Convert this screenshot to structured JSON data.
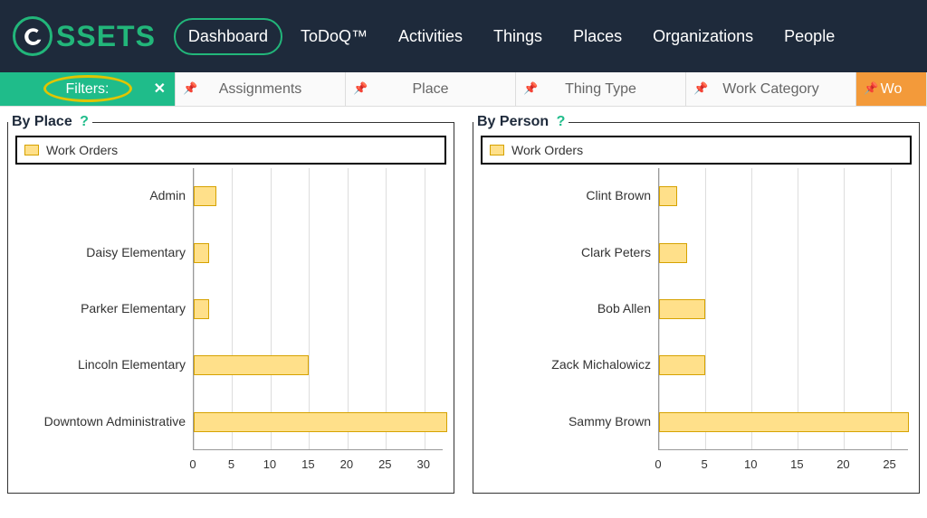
{
  "brand": {
    "name": "SSETS"
  },
  "nav": {
    "items": [
      {
        "label": "Dashboard",
        "active": true
      },
      {
        "label": "ToDoQ™"
      },
      {
        "label": "Activities"
      },
      {
        "label": "Things"
      },
      {
        "label": "Places"
      },
      {
        "label": "Organizations"
      },
      {
        "label": "People"
      }
    ]
  },
  "filters": {
    "label": "Filters:",
    "close": "✕",
    "tabs": [
      {
        "label": "Assignments"
      },
      {
        "label": "Place"
      },
      {
        "label": "Thing Type"
      },
      {
        "label": "Work Category"
      },
      {
        "label": "Wo",
        "orange": true
      }
    ]
  },
  "colors": {
    "accent": "#1fbc8a",
    "bar_fill": "#ffe08a",
    "bar_stroke": "#d6a200",
    "highlight_ring": "#e0c500",
    "nav_bg": "#1e2a3b",
    "orange": "#f39a3a"
  },
  "panels": {
    "by_place": {
      "title": "By Place",
      "help": "?",
      "legend": "Work Orders"
    },
    "by_person": {
      "title": "By Person",
      "help": "?",
      "legend": "Work Orders"
    }
  },
  "chart_data": [
    {
      "type": "bar",
      "orientation": "horizontal",
      "title": "By Place",
      "series_name": "Work Orders",
      "xlabel": "",
      "ylabel": "",
      "xlim": [
        0,
        32.5
      ],
      "xticks": [
        0,
        5,
        10,
        15,
        20,
        25,
        30
      ],
      "categories": [
        "Admin",
        "Daisy Elementary",
        "Parker Elementary",
        "Lincoln Elementary",
        "Downtown Administrative"
      ],
      "values": [
        3,
        2,
        2,
        15,
        33
      ]
    },
    {
      "type": "bar",
      "orientation": "horizontal",
      "title": "By Person",
      "series_name": "Work Orders",
      "xlabel": "",
      "ylabel": "",
      "xlim": [
        0,
        27
      ],
      "xticks": [
        0,
        5,
        10,
        15,
        20,
        25
      ],
      "categories": [
        "Clint Brown",
        "Clark Peters",
        "Bob Allen",
        "Zack Michalowicz",
        "Sammy Brown"
      ],
      "values": [
        2,
        3,
        5,
        5,
        27
      ]
    }
  ]
}
